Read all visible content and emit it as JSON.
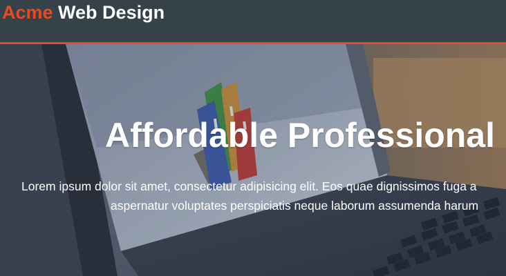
{
  "header": {
    "brand_highlight": "Acme",
    "brand_rest": " Web Design",
    "accent_color": "#e8491d",
    "background_color": "#35424a"
  },
  "showcase": {
    "title": "Affordable Professional",
    "text_line_1": "Lorem ipsum dolor sit amet, consectetur adipisicing elit. Eos quae dignissimos fuga a",
    "text_line_2": "aspernatur voluptates perspiciatis neque laborum assumenda harum",
    "background_image": "laptop-with-colored-folders"
  }
}
